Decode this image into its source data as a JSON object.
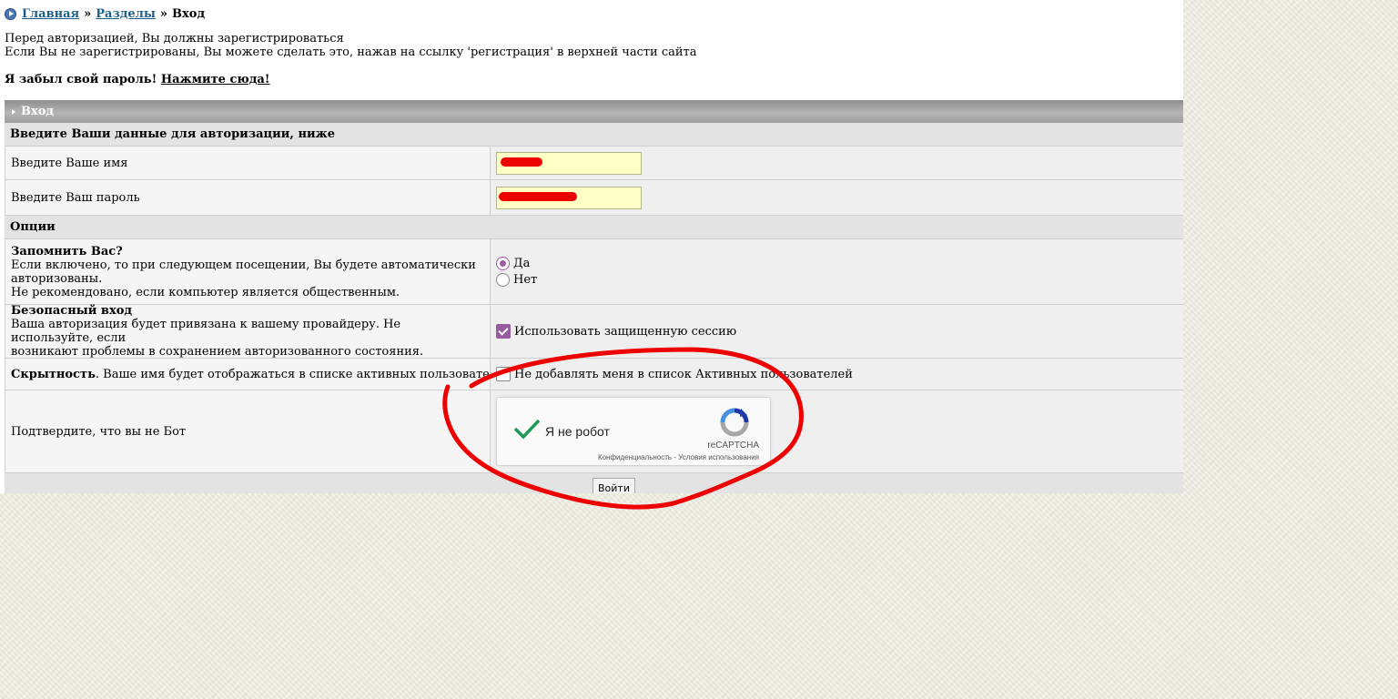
{
  "breadcrumb": {
    "icon": "circle-arrow-icon",
    "home": "Главная",
    "sections": "Разделы",
    "current": "Вход",
    "separator": "»"
  },
  "intro": {
    "line1": "Перед авторизацией, Вы должны зарегистрироваться",
    "line2": "Если Вы не зарегистрированы, Вы можете сделать это, нажав на ссылку 'регистрация' в верхней части сайта"
  },
  "forgot": {
    "text": "Я забыл свой пароль!",
    "link": "Нажмите сюда!"
  },
  "login": {
    "title": "Вход",
    "credentials_header": "Введите Ваши данные для авторизации, ниже",
    "username_label": "Введите Ваше имя",
    "username_value": "",
    "password_label": "Введите Ваш пароль",
    "password_value": "",
    "options_header": "Опции",
    "remember": {
      "title": "Запомнить Вас?",
      "desc1": "Если включено, то при следующем посещении, Вы будете автоматически",
      "desc2": "авторизованы.",
      "desc3": "Не рекомендовано, если компьютер является общественным.",
      "yes": "Да",
      "no": "Нет",
      "selected": "Да"
    },
    "secure": {
      "title": "Безопасный вход",
      "desc1": "Ваша авторизация будет привязана к вашему провайдеру. Не используйте, если",
      "desc2": "возникают проблемы в сохранением авторизованного состояния.",
      "checkbox_label": "Использовать защищенную сессию",
      "checked": true
    },
    "hidden": {
      "title": "Скрытность",
      "desc": ". Ваше имя будет отображаться в списке активных пользователей.",
      "checkbox_label": "Не добавлять меня в список Активных пользователей",
      "checked": false
    },
    "bot": {
      "label": "Подтвердите, что вы не Бот",
      "captcha_label": "Я не робот",
      "captcha_brand": "reCAPTCHA",
      "captcha_terms": "Конфиденциальность - Условия использования",
      "captcha_checked": true
    },
    "submit_label": "Войти"
  },
  "colors": {
    "link": "#1d5f8a",
    "accent": "#9a5aa0",
    "input_bg": "#ffffc6",
    "annotation": "#ee0000"
  }
}
